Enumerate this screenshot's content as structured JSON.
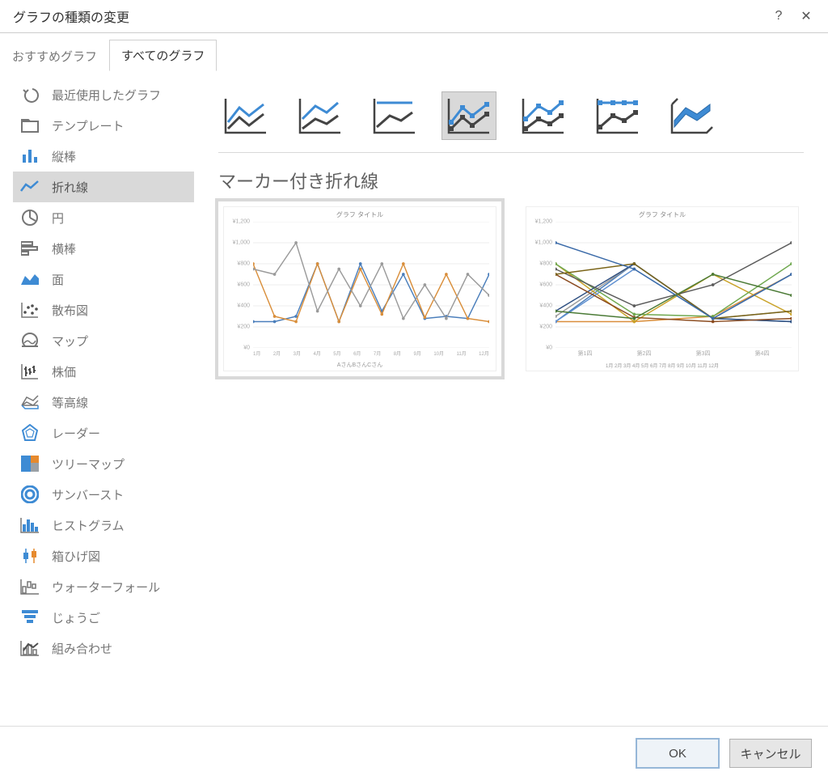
{
  "dialog": {
    "title": "グラフの種類の変更",
    "help": "?",
    "close": "✕"
  },
  "tabs": {
    "recommended": "おすすめグラフ",
    "all": "すべてのグラフ"
  },
  "sidebar": [
    {
      "key": "recent",
      "label": "最近使用したグラフ"
    },
    {
      "key": "template",
      "label": "テンプレート"
    },
    {
      "key": "column",
      "label": "縦棒"
    },
    {
      "key": "line",
      "label": "折れ線",
      "selected": true
    },
    {
      "key": "pie",
      "label": "円"
    },
    {
      "key": "bar",
      "label": "横棒"
    },
    {
      "key": "area",
      "label": "面"
    },
    {
      "key": "scatter",
      "label": "散布図"
    },
    {
      "key": "map",
      "label": "マップ"
    },
    {
      "key": "stock",
      "label": "株価"
    },
    {
      "key": "surface",
      "label": "等高線"
    },
    {
      "key": "radar",
      "label": "レーダー"
    },
    {
      "key": "treemap",
      "label": "ツリーマップ"
    },
    {
      "key": "sunburst",
      "label": "サンバースト"
    },
    {
      "key": "histogram",
      "label": "ヒストグラム"
    },
    {
      "key": "boxwhisker",
      "label": "箱ひげ図"
    },
    {
      "key": "waterfall",
      "label": "ウォーターフォール"
    },
    {
      "key": "funnel",
      "label": "じょうご"
    },
    {
      "key": "combo",
      "label": "組み合わせ"
    }
  ],
  "subtypes": [
    {
      "key": "line",
      "selected": false
    },
    {
      "key": "stacked-line",
      "selected": false
    },
    {
      "key": "100-stacked-line",
      "selected": false
    },
    {
      "key": "line-markers",
      "selected": true
    },
    {
      "key": "stacked-line-markers",
      "selected": false
    },
    {
      "key": "100-stacked-line-markers",
      "selected": false
    },
    {
      "key": "3d-line",
      "selected": false
    }
  ],
  "subtype_title": "マーカー付き折れ線",
  "preview": {
    "title": "グラフ タイトル",
    "y_ticks": [
      "¥1,200",
      "¥1,000",
      "¥800",
      "¥600",
      "¥400",
      "¥200",
      "¥0"
    ],
    "x_ticks_a": [
      "1月",
      "2月",
      "3月",
      "4月",
      "5月",
      "6月",
      "7月",
      "8月",
      "9月",
      "10月",
      "11月",
      "12月"
    ],
    "x_ticks_b": [
      "第1四",
      "第2四",
      "第3四",
      "第4四"
    ],
    "legend_a": [
      "AさんBさんCさん"
    ],
    "legend_b": [
      "1月 2月 3月 4月 5月 6月 7月 8月 9月 10月 11月 12月"
    ]
  },
  "buttons": {
    "ok": "OK",
    "cancel": "キャンセル"
  },
  "chart_data": [
    {
      "type": "line",
      "title": "グラフ タイトル",
      "x": [
        "1月",
        "2月",
        "3月",
        "4月",
        "5月",
        "6月",
        "7月",
        "8月",
        "9月",
        "10月",
        "11月",
        "12月"
      ],
      "series": [
        {
          "name": "Aさん",
          "values": [
            250,
            250,
            300,
            800,
            250,
            800,
            350,
            700,
            280,
            300,
            280,
            700
          ]
        },
        {
          "name": "Bさん",
          "values": [
            800,
            300,
            250,
            800,
            250,
            750,
            320,
            800,
            290,
            700,
            280,
            250
          ]
        },
        {
          "name": "Cさん",
          "values": [
            750,
            700,
            1000,
            350,
            750,
            400,
            800,
            280,
            600,
            280,
            700,
            500
          ]
        }
      ],
      "ylim": [
        0,
        1200
      ],
      "ylabel": "",
      "xlabel": ""
    },
    {
      "type": "line",
      "title": "グラフ タイトル",
      "x": [
        "第1四",
        "第2四",
        "第3四",
        "第4四"
      ],
      "series": [
        {
          "name": "1月",
          "values": [
            250,
            800,
            280,
            250
          ]
        },
        {
          "name": "2月",
          "values": [
            250,
            250,
            300,
            700
          ]
        },
        {
          "name": "3月",
          "values": [
            300,
            800,
            280,
            350
          ]
        },
        {
          "name": "4月",
          "values": [
            800,
            250,
            700,
            320
          ]
        },
        {
          "name": "5月",
          "values": [
            250,
            750,
            280,
            700
          ]
        },
        {
          "name": "6月",
          "values": [
            800,
            320,
            300,
            800
          ]
        },
        {
          "name": "7月",
          "values": [
            350,
            800,
            280,
            250
          ]
        },
        {
          "name": "8月",
          "values": [
            700,
            290,
            250,
            280
          ]
        },
        {
          "name": "9月",
          "values": [
            750,
            400,
            600,
            1000
          ]
        },
        {
          "name": "10月",
          "values": [
            700,
            800,
            280,
            350
          ]
        },
        {
          "name": "11月",
          "values": [
            1000,
            750,
            280,
            700
          ]
        },
        {
          "name": "12月",
          "values": [
            350,
            280,
            700,
            500
          ]
        }
      ],
      "ylim": [
        0,
        1200
      ],
      "ylabel": "",
      "xlabel": ""
    }
  ]
}
